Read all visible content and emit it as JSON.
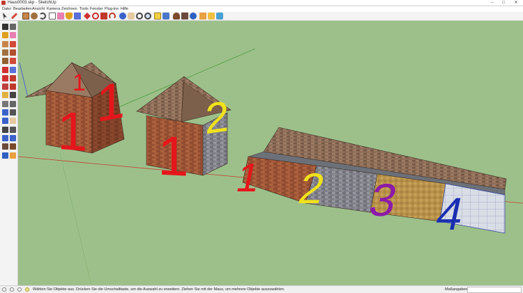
{
  "window": {
    "title": "Haus0003.skp - SketchUp",
    "minimize": "–",
    "maximize": "□",
    "close": "✕",
    "app_icon": "sketchup-logo-icon"
  },
  "menu": [
    "Datei",
    "Bearbeiten",
    "Ansicht",
    "Kamera",
    "Zeichnen",
    "Tools",
    "Fenster",
    "Plug-ins",
    "Hilfe"
  ],
  "toolbar": {
    "tools": [
      "select-icon",
      "eraser-icon",
      "pencil-icon",
      "rectangle-icon",
      "circle-icon",
      "arc-icon",
      "make-component-icon",
      "eraser-icon",
      "paint-bucket-icon",
      "push-pull-icon",
      "move-icon",
      "rotate-icon",
      "offset-icon",
      "follow-me-icon",
      "orbit-icon",
      "pan-icon",
      "zoom-icon",
      "zoom-extents-icon",
      "warehouse-icon",
      "extension-icon",
      "walk-icon",
      "position-camera-icon",
      "look-around-icon",
      "section-icon",
      "add-location-icon",
      "share-model-icon"
    ]
  },
  "left_toolbar": {
    "tools": [
      "select-icon",
      "make-component-icon",
      "paint-bucket-icon",
      "eraser-icon",
      "rectangle-icon",
      "line-icon",
      "circle-icon",
      "arc-icon",
      "polygon-icon",
      "freehand-icon",
      "move-icon",
      "push-pull-icon",
      "rotate-icon",
      "follow-me-icon",
      "scale-icon",
      "offset-icon",
      "tape-measure-icon",
      "dimension-icon",
      "protractor-icon",
      "text-icon",
      "axes-icon",
      "3d-text-icon",
      "orbit-icon",
      "pan-icon",
      "zoom-icon",
      "zoom-window-icon",
      "previous-view-icon",
      "zoom-extents-icon",
      "position-camera-icon",
      "walk-icon",
      "look-around-icon",
      "section-plane-icon"
    ]
  },
  "scene": {
    "objects": [
      "house-1",
      "house-2",
      "flat-roof-panel"
    ],
    "house1_labels": [
      "1",
      "1",
      "1"
    ],
    "house2_labels": [
      "1",
      "2"
    ],
    "panel_labels": [
      "1",
      "2",
      "3",
      "4"
    ],
    "colors": {
      "sky_ground": "#9dc08b",
      "brick": "#9c5436",
      "brick_dark": "#7e4028",
      "roof": "#8a6a55",
      "label_red": "#e5161b",
      "label_yellow": "#f0e21c",
      "label_purple": "#8b1aa8",
      "label_blue": "#1a2fb0",
      "axis_red": "#c24030",
      "axis_green": "#4c9a3c",
      "axis_blue": "#3a4ecf"
    }
  },
  "status": {
    "hint": "Wählen Sie Objekte aus. Drücken Sie die Umschalttaste, um die Auswahl zu erweitern. Ziehen Sie mit der Maus, um mehrere Objekte auszuwählen.",
    "measurements_label": "Maßangaben",
    "measurements_value": ""
  }
}
